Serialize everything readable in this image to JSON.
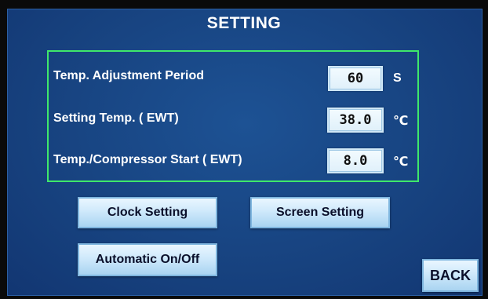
{
  "title": "SETTING",
  "settings": [
    {
      "label": "Temp. Adjustment Period",
      "value": "60",
      "unit": "S"
    },
    {
      "label": "Setting  Temp. ( EWT)",
      "value": "38.0",
      "unit": "℃"
    },
    {
      "label": "Temp./Compressor Start ( EWT)",
      "value": "8.0",
      "unit": "℃"
    }
  ],
  "buttons": {
    "clock": "Clock Setting",
    "screen": "Screen Setting",
    "auto": "Automatic On/Off",
    "back": "BACK"
  },
  "colors": {
    "panel": "#17427f",
    "frame": "#3fe86a",
    "button": "#cfe9fb"
  }
}
